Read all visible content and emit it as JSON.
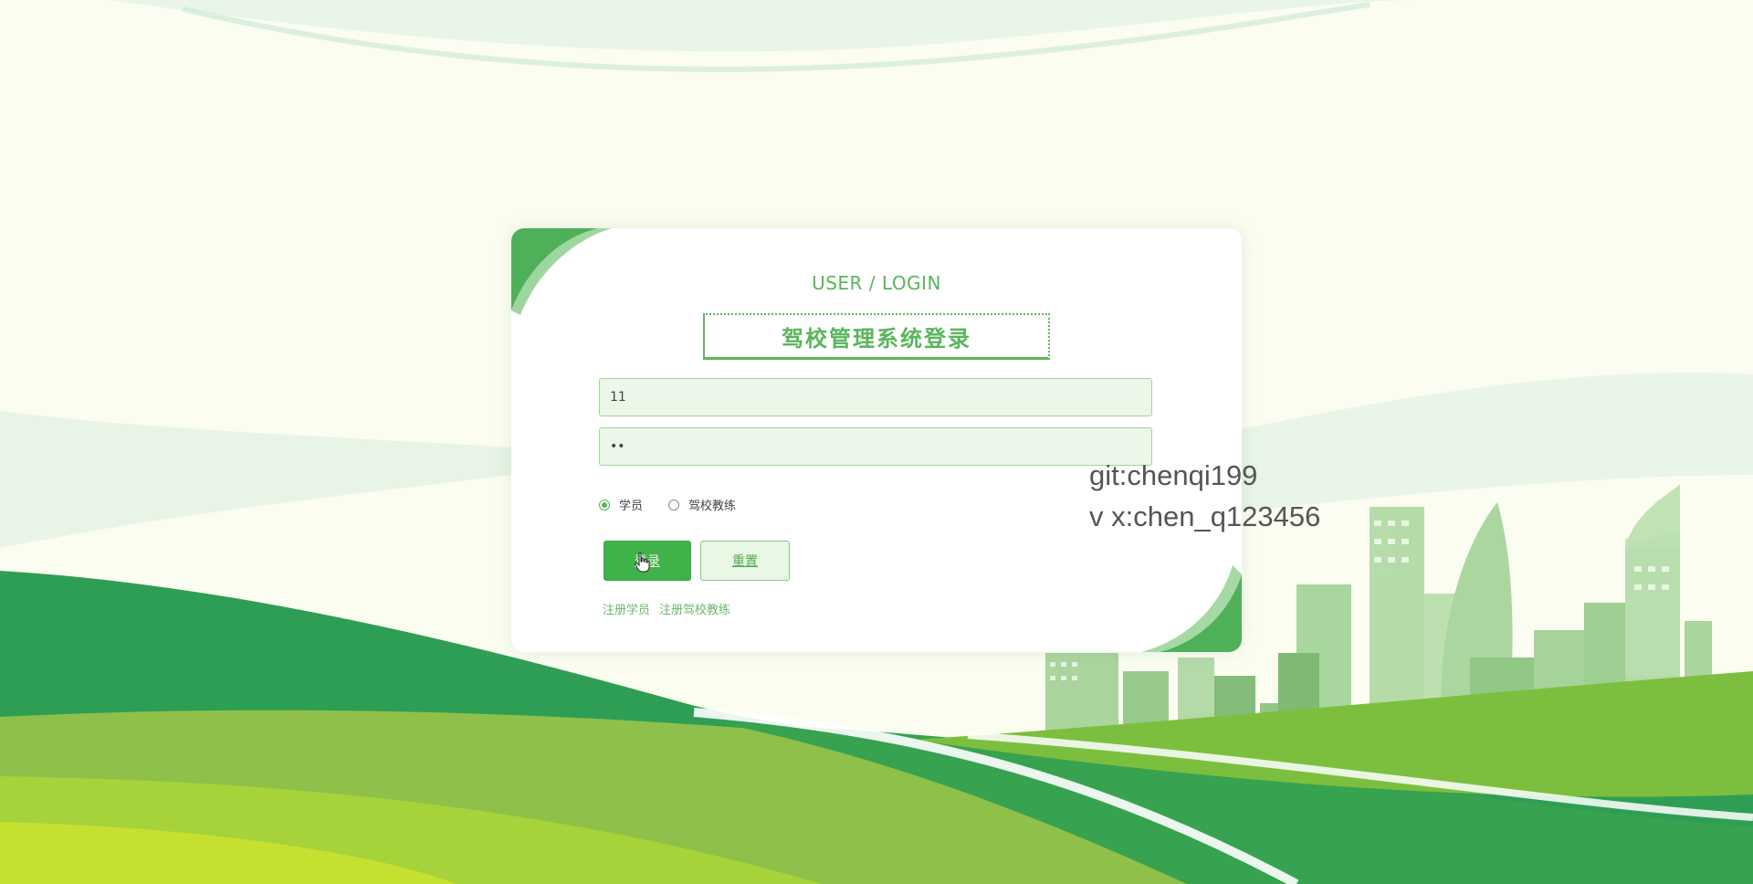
{
  "login": {
    "subtitle": "USER / LOGIN",
    "title": "驾校管理系统登录",
    "username_value": "11",
    "password_value": "11",
    "roles": [
      {
        "label": "学员",
        "checked": true
      },
      {
        "label": "驾校教练",
        "checked": false
      }
    ],
    "login_label": "登录",
    "reset_label": "重置",
    "links": [
      "注册学员",
      "注册驾校教练"
    ]
  },
  "watermark": {
    "line1": "git:chenqi199",
    "line2": "v x:chen_q123456"
  },
  "colors": {
    "accent": "#5ab55c",
    "button": "#3fb34a",
    "background": "#fbfdf1"
  },
  "icons": [
    "pointer-cursor-icon",
    "radio-icon"
  ]
}
